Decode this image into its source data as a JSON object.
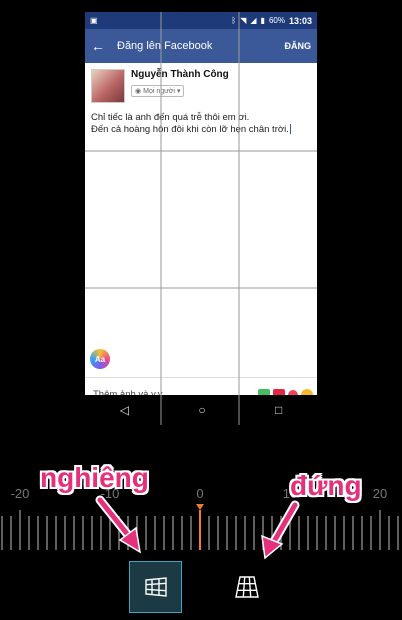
{
  "status_bar": {
    "battery": "60%",
    "time": "13:03"
  },
  "app_bar": {
    "back_icon": "arrow-back-icon",
    "title": "Đăng lên Facebook",
    "post_label": "ĐĂNG"
  },
  "composer": {
    "author_name": "Nguyễn Thành Công",
    "audience": "Mọi người",
    "post_lines": [
      "Chỉ tiếc là anh đến quá trễ thôi em ơi.",
      "Đến cả hoàng hôn đôi khi còn lỡ hẹn chân trời."
    ],
    "text_style_button": "Aa",
    "attach_label": "Thêm ảnh và v.v."
  },
  "ruler": {
    "labels": [
      "-20",
      "-10",
      "0",
      "10",
      "20"
    ],
    "current_value": 0
  },
  "annotations": {
    "tilt": "nghiêng",
    "vertical": "đứng"
  },
  "tools": {
    "tilt_icon": "horizontal-perspective-icon",
    "vertical_icon": "vertical-perspective-icon",
    "active": "tilt"
  },
  "colors": {
    "facebook_blue": "#3b5998",
    "accent_orange": "#f07a2d",
    "annotation_pink": "#e5307c",
    "active_tool_border": "#3aa5c2"
  }
}
